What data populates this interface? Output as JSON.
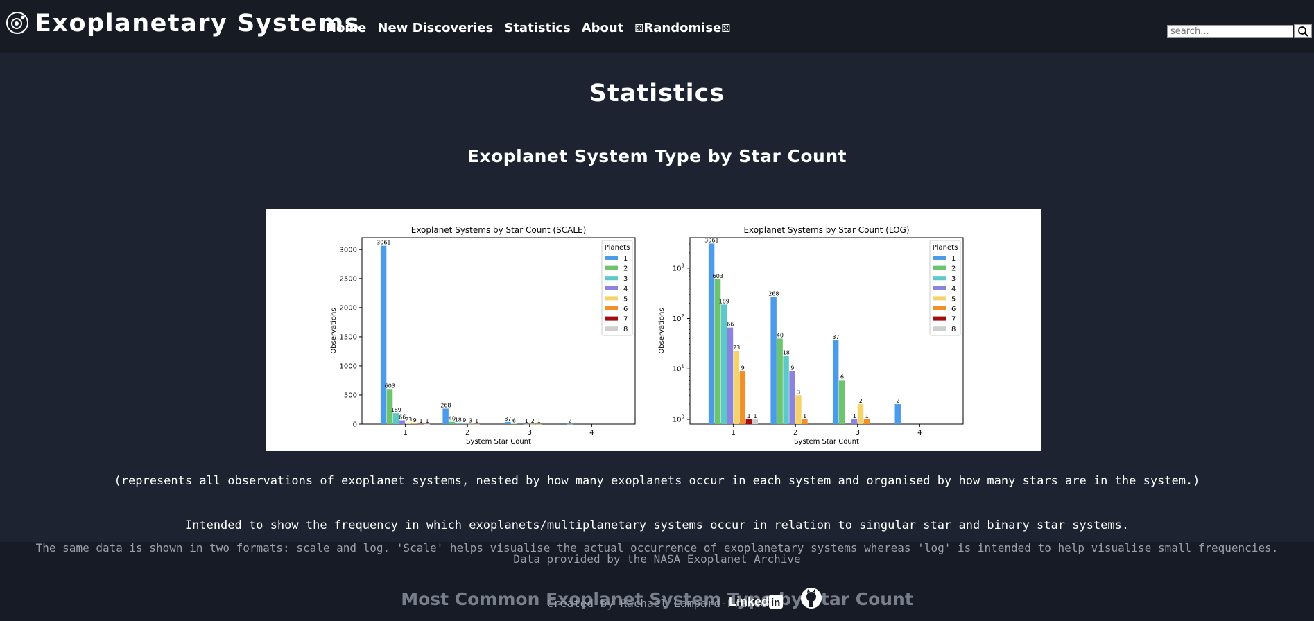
{
  "header": {
    "title": "Exoplanetary Systems",
    "logo_icon": "planet-logo-icon",
    "nav": [
      "Home",
      "New Discoveries",
      "Statistics",
      "About"
    ],
    "randomise_label": "Randomise",
    "search_placeholder": "search...",
    "search_icon": "search-icon"
  },
  "main": {
    "page_title": "Statistics",
    "section_title": "Exoplanet System Type by Star Count",
    "caption": "(represents all observations of exoplanet systems, nested by how many exoplanets occur in each system and organised by how many stars are in the system.)",
    "intended": "Intended to show the frequency in which exoplanets/multiplanetary systems occur in relation to singular star and binary star systems.",
    "formats_note": "The same data is shown in two formats: scale and log. 'Scale' helps visualise the actual occurrence of exoplanetary systems whereas 'log' is intended to help visualise small frequencies.",
    "source_note": "Data provided by the NASA Exoplanet Archive",
    "next_section_title": "Most Common Exoplanet System Type by Star Count"
  },
  "footer": {
    "credit": "Created by Rachael Lampard-France",
    "linkedin_label": "Linked",
    "linkedin_icon": "linkedin-icon",
    "github_icon": "github-icon"
  },
  "colors": {
    "background": "#1d2331",
    "topbar": "#161b24",
    "series": [
      "#4c9be8",
      "#6cc46c",
      "#5cc8c8",
      "#8a84e0",
      "#f5d36b",
      "#f0902a",
      "#a30d0d",
      "#cfcfcf"
    ]
  },
  "chart_data": [
    {
      "type": "bar",
      "title": "Exoplanet Systems by Star Count (SCALE)",
      "xlabel": "System Star Count",
      "ylabel": "Observations",
      "categories": [
        "1",
        "2",
        "3",
        "4"
      ],
      "ylim": [
        0,
        3200
      ],
      "yticks": [
        0,
        500,
        1000,
        1500,
        2000,
        2500,
        3000
      ],
      "legend_title": "Planets",
      "legend_position": "top-right",
      "series": [
        {
          "name": "1",
          "values": [
            3061,
            268,
            37,
            2
          ]
        },
        {
          "name": "2",
          "values": [
            603,
            40,
            6,
            null
          ]
        },
        {
          "name": "3",
          "values": [
            189,
            18,
            null,
            null
          ]
        },
        {
          "name": "4",
          "values": [
            66,
            9,
            1,
            null
          ]
        },
        {
          "name": "5",
          "values": [
            23,
            3,
            2,
            null
          ]
        },
        {
          "name": "6",
          "values": [
            9,
            1,
            1,
            null
          ]
        },
        {
          "name": "7",
          "values": [
            1,
            null,
            null,
            null
          ]
        },
        {
          "name": "8",
          "values": [
            1,
            null,
            null,
            null
          ]
        }
      ]
    },
    {
      "type": "bar",
      "title": "Exoplanet Systems by Star Count (LOG)",
      "xlabel": "System Star Count",
      "ylabel": "Observations",
      "yscale": "log",
      "categories": [
        "1",
        "2",
        "3",
        "4"
      ],
      "ylim": [
        0.8,
        4000
      ],
      "yticks": [
        "10^0",
        "10^1",
        "10^2",
        "10^3"
      ],
      "legend_title": "Planets",
      "legend_position": "top-right",
      "series": [
        {
          "name": "1",
          "values": [
            3061,
            268,
            37,
            2
          ]
        },
        {
          "name": "2",
          "values": [
            603,
            40,
            6,
            null
          ]
        },
        {
          "name": "3",
          "values": [
            189,
            18,
            null,
            null
          ]
        },
        {
          "name": "4",
          "values": [
            66,
            9,
            1,
            null
          ]
        },
        {
          "name": "5",
          "values": [
            23,
            3,
            2,
            null
          ]
        },
        {
          "name": "6",
          "values": [
            9,
            1,
            1,
            null
          ]
        },
        {
          "name": "7",
          "values": [
            1,
            null,
            null,
            null
          ]
        },
        {
          "name": "8",
          "values": [
            1,
            null,
            null,
            null
          ]
        }
      ]
    }
  ]
}
